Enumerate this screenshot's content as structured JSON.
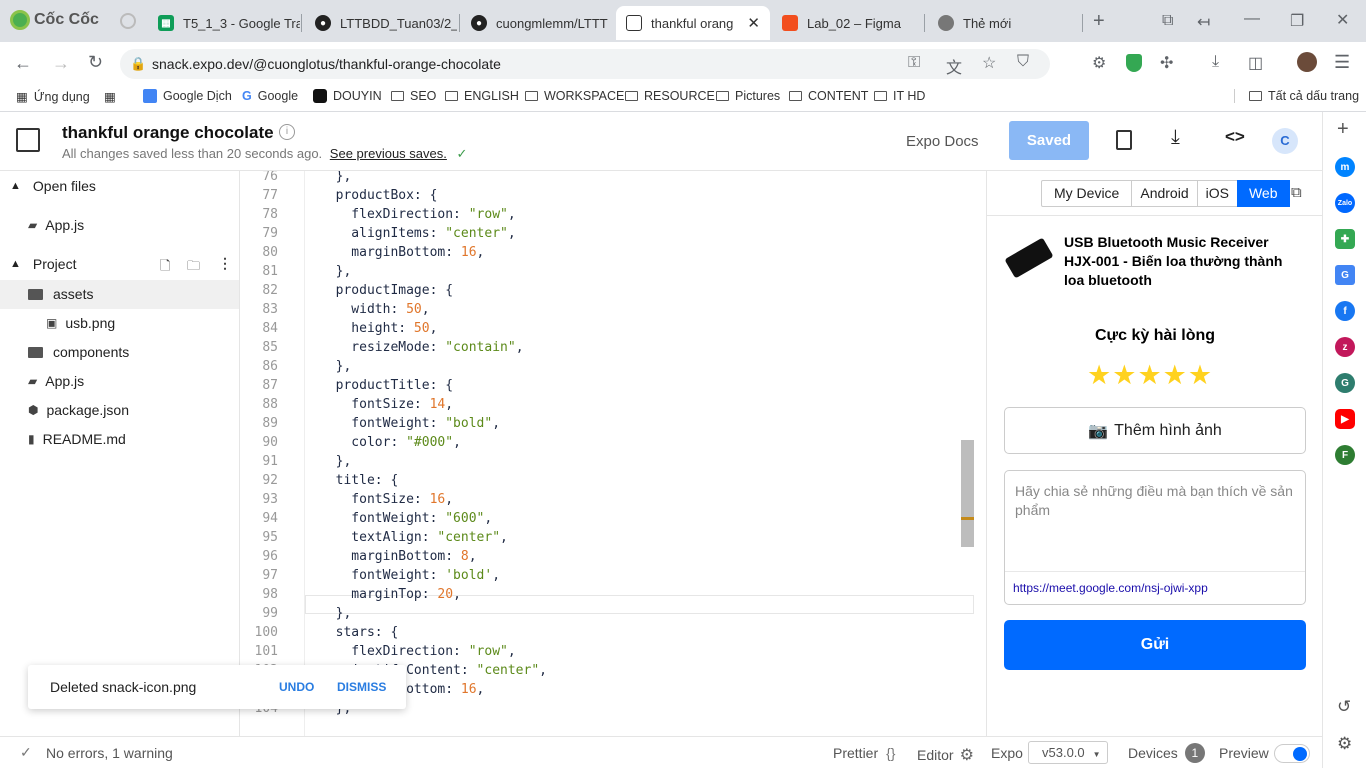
{
  "browser": {
    "brand": "Cốc Cốc",
    "tabs": [
      {
        "title": "T5_1_3 - Google Tra",
        "icon": "sheets-icon"
      },
      {
        "title": "LTTBDD_Tuan03/2_",
        "icon": "github-icon"
      },
      {
        "title": "cuongmlemm/LTTT",
        "icon": "github-icon"
      },
      {
        "title": "thankful orang",
        "icon": "snack-icon",
        "active": true
      },
      {
        "title": "Lab_02 – Figma",
        "icon": "figma-icon"
      },
      {
        "title": "Thẻ mới",
        "icon": "newtab-icon"
      }
    ],
    "url": "snack.expo.dev/@cuonglotus/thankful-orange-chocolate",
    "bookmarks": [
      "Ứng dụng",
      "Google Dịch",
      "Google",
      "DOUYIN",
      "SEO",
      "ENGLISH",
      "WORKSPACE",
      "RESOURCE",
      "Pictures",
      "CONTENT",
      "IT HD"
    ],
    "bookmarks_all": "Tất cả dấu trang"
  },
  "snack": {
    "project_title": "thankful orange chocolate",
    "save_status": "All changes saved less than 20 seconds ago.",
    "see_previous": "See previous saves.",
    "expo_docs": "Expo Docs",
    "saved_btn": "Saved",
    "avatar_letter": "C"
  },
  "filetree": {
    "open_files": "Open files",
    "open_file_item": "App.js",
    "project": "Project",
    "items": [
      "assets",
      "usb.png",
      "components",
      "App.js",
      "package.json",
      "README.md"
    ]
  },
  "editor": {
    "lines": [
      {
        "n": "76",
        "t": "  },"
      },
      {
        "n": "77",
        "t": "  productBox: {"
      },
      {
        "n": "78",
        "t": "    flexDirection: \"row\","
      },
      {
        "n": "79",
        "t": "    alignItems: \"center\","
      },
      {
        "n": "80",
        "t": "    marginBottom: 16,"
      },
      {
        "n": "81",
        "t": "  },"
      },
      {
        "n": "82",
        "t": "  productImage: {"
      },
      {
        "n": "83",
        "t": "    width: 50,"
      },
      {
        "n": "84",
        "t": "    height: 50,"
      },
      {
        "n": "85",
        "t": "    resizeMode: \"contain\","
      },
      {
        "n": "86",
        "t": "  },"
      },
      {
        "n": "87",
        "t": "  productTitle: {"
      },
      {
        "n": "88",
        "t": "    fontSize: 14,"
      },
      {
        "n": "89",
        "t": "    fontWeight: \"bold\","
      },
      {
        "n": "90",
        "t": "    color: \"#000\","
      },
      {
        "n": "91",
        "t": "  },"
      },
      {
        "n": "92",
        "t": "  title: {"
      },
      {
        "n": "93",
        "t": "    fontSize: 16,"
      },
      {
        "n": "94",
        "t": "    fontWeight: \"600\","
      },
      {
        "n": "95",
        "t": "    textAlign: \"center\","
      },
      {
        "n": "96",
        "t": "    marginBottom: 8,"
      },
      {
        "n": "97",
        "t": "    fontWeight: 'bold',"
      },
      {
        "n": "98",
        "t": "    marginTop: 20,"
      },
      {
        "n": "99",
        "t": "  },"
      },
      {
        "n": "100",
        "t": "  stars: {"
      },
      {
        "n": "101",
        "t": "    flexDirection: \"row\","
      },
      {
        "n": "102",
        "t": "    justifyContent: \"center\","
      },
      {
        "n": "103",
        "t": "    marginBottom: 16,"
      },
      {
        "n": "104",
        "t": "  },"
      }
    ]
  },
  "preview": {
    "device_tabs": [
      "My Device",
      "Android",
      "iOS",
      "Web"
    ],
    "active_tab": "Web",
    "product_title": "USB Bluetooth Music Receiver HJX-001 - Biến loa thường thành loa bluetooth",
    "rating_title": "Cực kỳ hài lòng",
    "stars": 5,
    "add_image": "Thêm hình ảnh",
    "textarea_placeholder": "Hãy chia sẻ những điều mà bạn thích về sản phẩm",
    "link": "https://meet.google.com/nsj-ojwi-xpp",
    "submit": "Gửi"
  },
  "toast": {
    "message": "Deleted snack-icon.png",
    "undo": "UNDO",
    "dismiss": "DISMISS"
  },
  "status": {
    "errors": "No errors, 1 warning",
    "prettier": "Prettier",
    "editor": "Editor",
    "expo": "Expo",
    "version": "v53.0.0",
    "devices": "Devices",
    "devices_count": "1",
    "preview": "Preview"
  },
  "colors": {
    "accent": "#006aff",
    "saved_btn": "#8ab8f5",
    "star": "#ffd21f",
    "code_string": "#5c8a1a",
    "code_number": "#e0762b"
  }
}
